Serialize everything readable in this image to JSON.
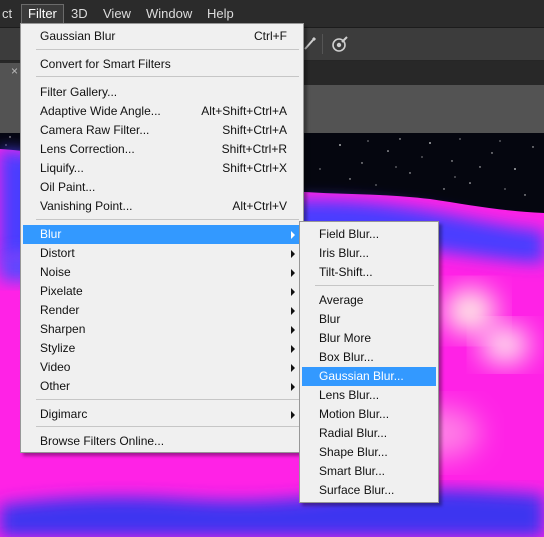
{
  "menubar": {
    "items": [
      {
        "label": "ct"
      },
      {
        "label": "Filter"
      },
      {
        "label": "3D"
      },
      {
        "label": "View"
      },
      {
        "label": "Window"
      },
      {
        "label": "Help"
      }
    ],
    "active": "Filter"
  },
  "tab": {
    "close_glyph": "×"
  },
  "filter_menu": {
    "items": [
      {
        "label": "Gaussian Blur",
        "shortcut": "Ctrl+F"
      },
      {
        "label": "Convert for Smart Filters",
        "shortcut": ""
      },
      {
        "label": "Filter Gallery...",
        "shortcut": ""
      },
      {
        "label": "Adaptive Wide Angle...",
        "shortcut": "Alt+Shift+Ctrl+A"
      },
      {
        "label": "Camera Raw Filter...",
        "shortcut": "Shift+Ctrl+A"
      },
      {
        "label": "Lens Correction...",
        "shortcut": "Shift+Ctrl+R"
      },
      {
        "label": "Liquify...",
        "shortcut": "Shift+Ctrl+X"
      },
      {
        "label": "Oil Paint...",
        "shortcut": ""
      },
      {
        "label": "Vanishing Point...",
        "shortcut": "Alt+Ctrl+V"
      },
      {
        "label": "Blur",
        "submenu": true,
        "highlighted": true
      },
      {
        "label": "Distort",
        "submenu": true
      },
      {
        "label": "Noise",
        "submenu": true
      },
      {
        "label": "Pixelate",
        "submenu": true
      },
      {
        "label": "Render",
        "submenu": true
      },
      {
        "label": "Sharpen",
        "submenu": true
      },
      {
        "label": "Stylize",
        "submenu": true
      },
      {
        "label": "Video",
        "submenu": true
      },
      {
        "label": "Other",
        "submenu": true
      },
      {
        "label": "Digimarc",
        "submenu": true
      },
      {
        "label": "Browse Filters Online..."
      }
    ]
  },
  "blur_submenu": {
    "items": [
      {
        "label": "Field Blur..."
      },
      {
        "label": "Iris Blur..."
      },
      {
        "label": "Tilt-Shift..."
      },
      {
        "label": "Average"
      },
      {
        "label": "Blur"
      },
      {
        "label": "Blur More"
      },
      {
        "label": "Box Blur..."
      },
      {
        "label": "Gaussian Blur...",
        "highlighted": true
      },
      {
        "label": "Lens Blur..."
      },
      {
        "label": "Motion Blur..."
      },
      {
        "label": "Radial Blur..."
      },
      {
        "label": "Shape Blur..."
      },
      {
        "label": "Smart Blur..."
      },
      {
        "label": "Surface Blur..."
      }
    ]
  },
  "colors": {
    "highlight": "#3399ff",
    "menu_bg": "#f0f0f0",
    "menubar_bg": "#2b2b2b"
  }
}
